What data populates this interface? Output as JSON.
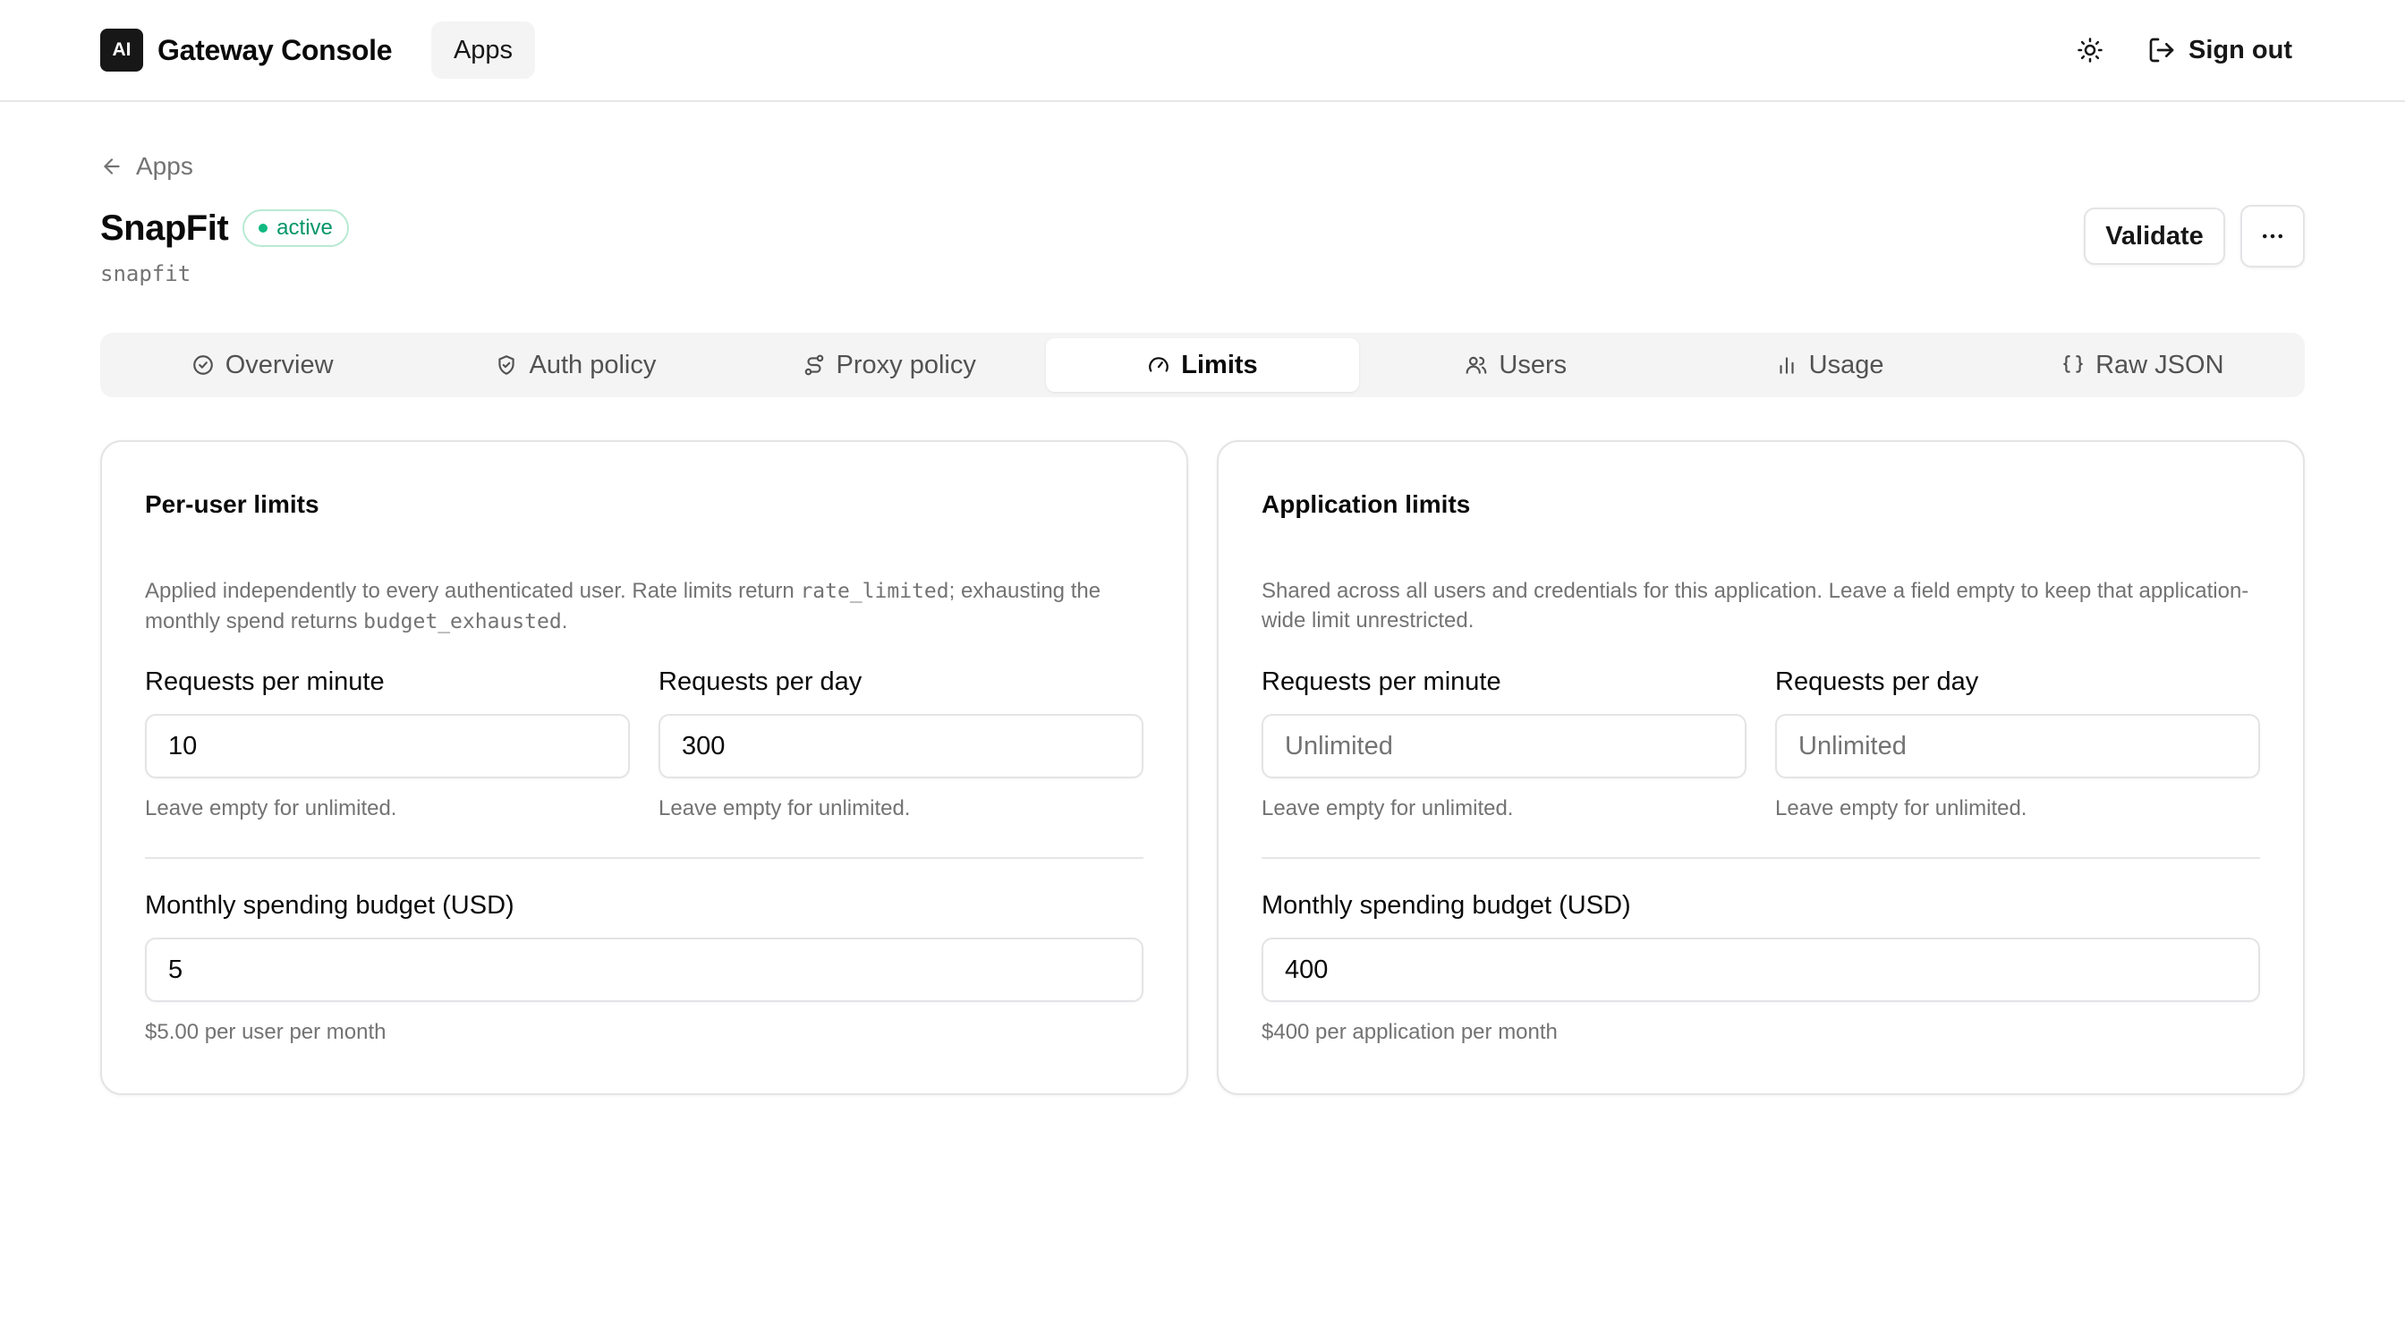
{
  "header": {
    "logo_text": "AI",
    "app_name": "Gateway Console",
    "nav_apps": "Apps",
    "theme_icon": "sun-icon",
    "signout_label": "Sign out",
    "signout_icon": "sign-out-icon"
  },
  "breadcrumb": {
    "back_label": "Apps"
  },
  "app": {
    "title": "SnapFit",
    "status": "active",
    "slug": "snapfit"
  },
  "actions": {
    "validate_label": "Validate",
    "more_icon": "more-horizontal-icon"
  },
  "tabs": [
    {
      "label": "Overview",
      "icon": "check-circle-icon"
    },
    {
      "label": "Auth policy",
      "icon": "shield-check-icon"
    },
    {
      "label": "Proxy policy",
      "icon": "route-icon"
    },
    {
      "label": "Limits",
      "icon": "gauge-icon",
      "active": true
    },
    {
      "label": "Users",
      "icon": "users-icon"
    },
    {
      "label": "Usage",
      "icon": "bar-chart-icon"
    },
    {
      "label": "Raw JSON",
      "icon": "braces-icon"
    }
  ],
  "per_user": {
    "title": "Per-user limits",
    "desc_1": "Applied independently to every authenticated user. Rate limits return ",
    "desc_code_1": "rate_limited",
    "desc_2": "; exhausting the monthly spend returns ",
    "desc_code_2": "budget_exhausted",
    "desc_3": ".",
    "rpm_label": "Requests per minute",
    "rpm_value": "10",
    "rpm_hint": "Leave empty for unlimited.",
    "rpd_label": "Requests per day",
    "rpd_value": "300",
    "rpd_hint": "Leave empty for unlimited.",
    "budget_label": "Monthly spending budget (USD)",
    "budget_value": "5",
    "budget_hint": "$5.00 per user per month"
  },
  "application": {
    "title": "Application limits",
    "desc": "Shared across all users and credentials for this application. Leave a field empty to keep that application-wide limit unrestricted.",
    "rpm_label": "Requests per minute",
    "rpm_placeholder": "Unlimited",
    "rpm_hint": "Leave empty for unlimited.",
    "rpd_label": "Requests per day",
    "rpd_placeholder": "Unlimited",
    "rpd_hint": "Leave empty for unlimited.",
    "budget_label": "Monthly spending budget (USD)",
    "budget_value": "400",
    "budget_hint": "$400 per application per month"
  },
  "colors": {
    "accent_active": "#10b981",
    "logo_bg": "#171717",
    "tab_bg": "#f4f4f5"
  }
}
